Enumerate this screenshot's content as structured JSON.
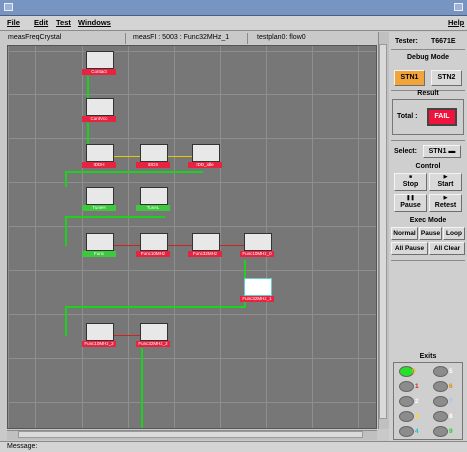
{
  "menu": {
    "items": [
      "File",
      "Edit",
      "Test",
      "Windows"
    ],
    "help": "Help"
  },
  "status": {
    "test_name": "measFreqCrystal",
    "meas": "measFI : 5003 : Func32MHz_1",
    "testplan": "testplan0: flow0"
  },
  "tester": {
    "label": "Tester:",
    "value": "T6671E"
  },
  "debug": {
    "title": "Debug Mode",
    "stn1": "STN1",
    "stn2": "STN2"
  },
  "result": {
    "title": "Result",
    "total_label": "Total :",
    "total_value": "FAIL"
  },
  "select": {
    "label": "Select:",
    "value": "STN1"
  },
  "control": {
    "title": "Control",
    "stop": "Stop",
    "start": "Start",
    "pause": "Pause",
    "retest": "Retest"
  },
  "exec": {
    "title": "Exec Mode",
    "normal": "Normal",
    "pause": "Pause",
    "loop": "Loop",
    "all_pause": "All Pause",
    "all_clear": "All Clear"
  },
  "exits": {
    "title": "Exits",
    "items": [
      "0",
      "5",
      "1",
      "6",
      "2",
      "7",
      "3",
      "8",
      "4",
      "9"
    ]
  },
  "message": {
    "label": "Message:"
  },
  "nodes": [
    "Contact",
    "ContVcc",
    "IDDH",
    "IDDS",
    "IDD_idle",
    "TuneH",
    "TuneL",
    "Func",
    "Func10MHz",
    "Func32MHz",
    "Func10MHz_0",
    "Func32MHz_1",
    "Func10MHz_2",
    "Func32MHz_2"
  ],
  "colors": {
    "fail": "#f0143c",
    "green_label": "#3ec83e",
    "red_label": "#e8233f",
    "canvas": "#777777",
    "wire_green": "#1fd11f"
  }
}
